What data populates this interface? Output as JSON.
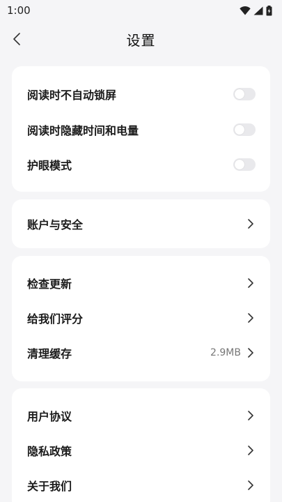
{
  "status_bar": {
    "time": "1:00"
  },
  "header": {
    "title": "设置"
  },
  "card_display": {
    "items": [
      {
        "label": "阅读时不自动锁屏",
        "toggle_on": false
      },
      {
        "label": "阅读时隐藏时间和电量",
        "toggle_on": false
      },
      {
        "label": "护眼模式",
        "toggle_on": false
      }
    ]
  },
  "card_account": {
    "items": [
      {
        "label": "账户与安全"
      }
    ]
  },
  "card_app": {
    "items": [
      {
        "label": "检查更新"
      },
      {
        "label": "给我们评分"
      },
      {
        "label": "清理缓存",
        "value": "2.9MB"
      }
    ]
  },
  "card_about": {
    "items": [
      {
        "label": "用户协议"
      },
      {
        "label": "隐私政策"
      },
      {
        "label": "关于我们"
      }
    ]
  },
  "colors": {
    "background": "#f5f5f7",
    "card": "#ffffff",
    "toggle_off": "#e9e9ec",
    "text": "#1b1b1b",
    "secondary": "#777777"
  }
}
